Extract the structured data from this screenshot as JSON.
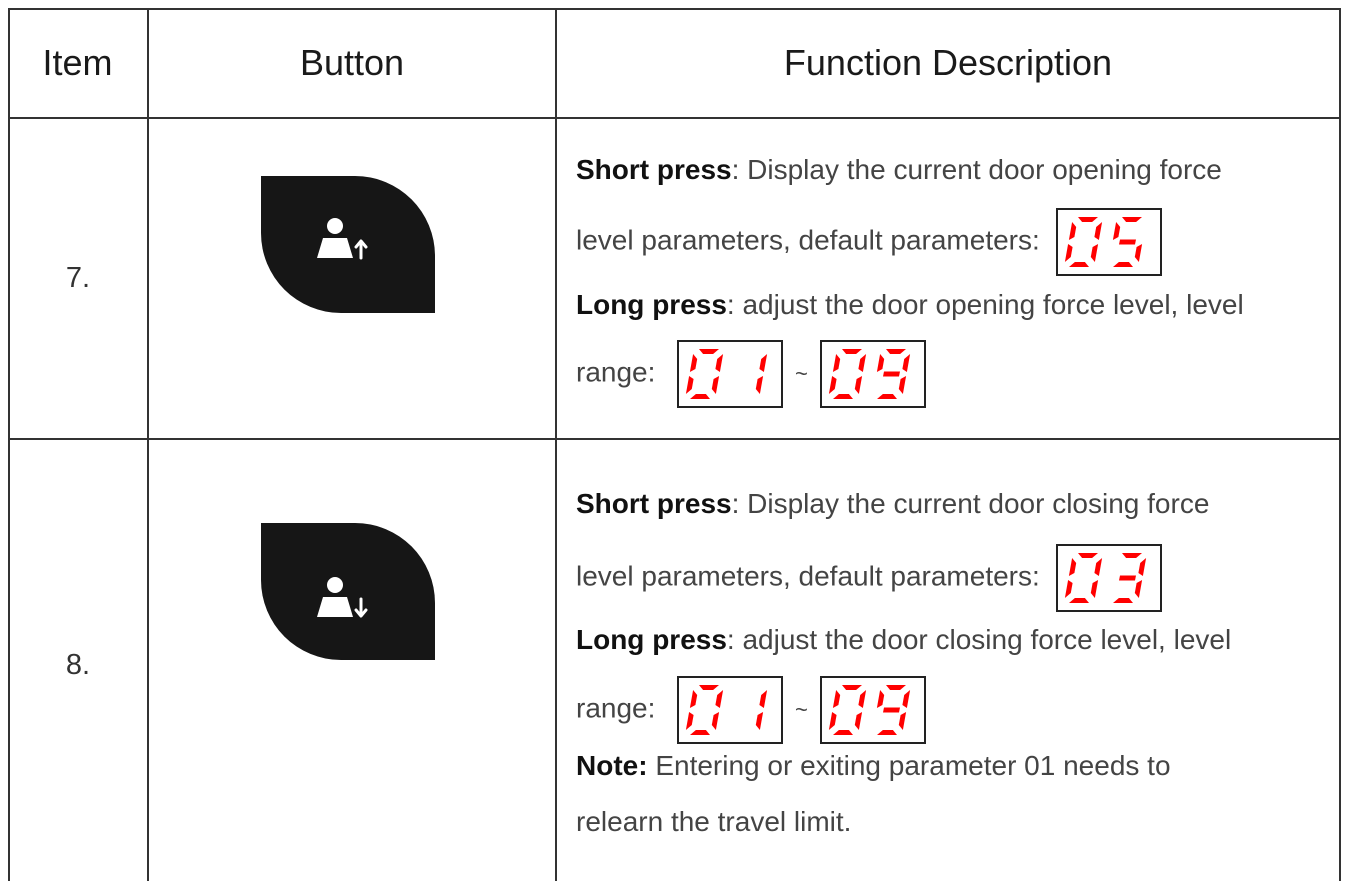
{
  "table": {
    "headers": {
      "item": "Item",
      "button": "Button",
      "function": "Function Description"
    },
    "rows": [
      {
        "item": "7.",
        "button_icon": "person-up-arrow-icon",
        "short_label": "Short press",
        "short_text": ": Display the current door opening force",
        "short_text2": "level parameters, default parameters:",
        "default_display": "05",
        "long_label": "Long press",
        "long_text": ": adjust the door opening force level, level",
        "long_text2": "range:",
        "range_min": "01",
        "range_sep": "~",
        "range_max": "09"
      },
      {
        "item": "8.",
        "button_icon": "person-down-arrow-icon",
        "short_label": "Short press",
        "short_text": ": Display the current door closing force",
        "short_text2": "level parameters, default parameters:",
        "default_display": "03",
        "long_label": "Long press",
        "long_text": ": adjust the door closing force level, level",
        "long_text2": "range:",
        "range_min": "01",
        "range_sep": "~",
        "range_max": "09",
        "note_label": "Note:",
        "note_text": " Entering or exiting parameter 01 needs to",
        "note_text2": "relearn the travel limit."
      }
    ]
  },
  "colors": {
    "segment_red": "#ff0000",
    "button_black": "#161616",
    "grid_line": "#333333"
  }
}
